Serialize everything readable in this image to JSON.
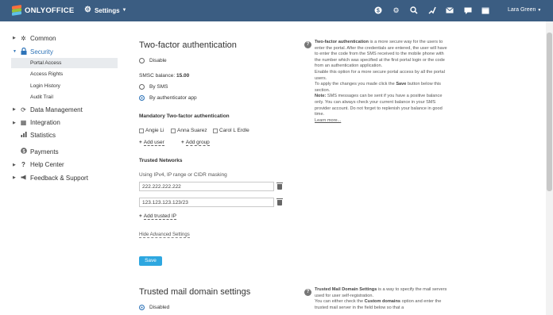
{
  "header": {
    "logo_text": "ONLYOFFICE",
    "module": "Settings",
    "user": "Lara Green",
    "icons": [
      "help-icon",
      "settings-icon",
      "search-icon",
      "feed-icon",
      "mail-icon",
      "chat-icon",
      "calendar-icon"
    ],
    "color": "#3b5d82"
  },
  "sidebar": {
    "common": "Common",
    "security": "Security",
    "security_sub": [
      "Portal Access",
      "Access Rights",
      "Login History",
      "Audit Trail"
    ],
    "data_management": "Data Management",
    "integration": "Integration",
    "statistics": "Statistics",
    "payments": "Payments",
    "help_center": "Help Center",
    "feedback": "Feedback & Support",
    "active_color": "#2f74b8"
  },
  "tfa": {
    "title": "Two-factor authentication",
    "disable": "Disable",
    "smsc_label": "SMSC balance:",
    "smsc_value": "15.00",
    "by_sms": "By SMS",
    "by_app": "By authenticator app",
    "mandatory_title": "Mandatory Two-factor authentication",
    "users": [
      "Angie Li",
      "Anna Suarez",
      "Carol L Erdle"
    ],
    "add_user": "Add user",
    "add_group": "Add group",
    "trusted_title": "Trusted Networks",
    "trusted_hint": "Using IPv4, IP range or CIDR masking",
    "ips": [
      "222.222.222.222",
      "123.123.123.123/23"
    ],
    "add_ip": "Add trusted IP",
    "hide_advanced": "Hide Advanced Settings",
    "save": "Save"
  },
  "help1": {
    "term": "Two-factor authentication",
    "p1": " is a more secure way for the users to enter the portal. After the credentials are entered, the user will have to enter the code from the SMS received to the mobile phone with the number which was specified at the first portal login or the code from an authentication application.",
    "p2": "Enable this option for a more secure portal access by all the portal users.",
    "p3a": "To apply the changes you made click the ",
    "p3b": "Save",
    "p3c": " button below this section.",
    "note_label": "Note:",
    "note": " SMS messages can be sent if you have a positive balance only. You can always check your current balance in your SMS provider account. Do not forget to replenish your balance in good time.",
    "learn_more": "Learn more..."
  },
  "mail": {
    "title": "Trusted mail domain settings",
    "disabled": "Disabled"
  },
  "help2": {
    "term": "Trusted Mail Domain Settings",
    "p1": " is a way to specify the mail servers used for user self-registration.",
    "p2a": "You can either check the ",
    "p2b": "Custom domains",
    "p2c": " option and enter the trusted mail server in the field below so that a"
  }
}
